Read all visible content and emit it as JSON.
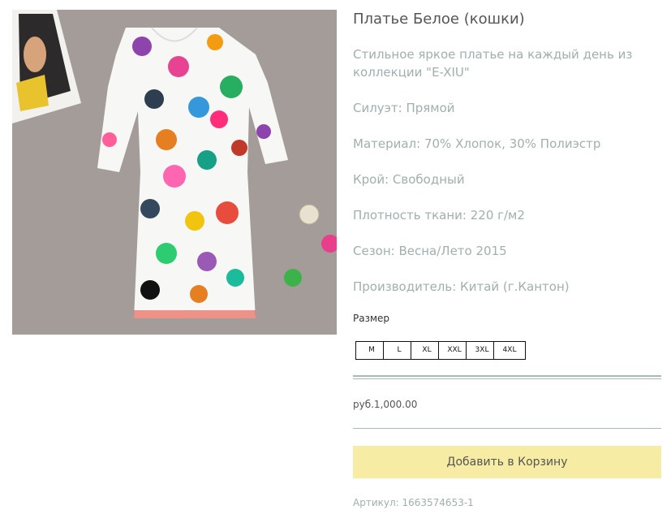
{
  "product": {
    "title": "Платье Белое (кошки)",
    "description": [
      "Стильное яркое платье на каждый день из коллекции \"E-XIU\"",
      "Силуэт: Прямой",
      "Материал: 70% Хлопок, 30% Полиэстр",
      "Крой: Свободный",
      "Плотность ткани: 220 г/м2",
      "Сезон: Весна/Лето 2015",
      "Производитель: Китай (г.Кантон)"
    ],
    "size_label": "Размер",
    "sizes": [
      "M",
      "L",
      "XL",
      "XXL",
      "3XL",
      "4XL"
    ],
    "price": "руб.1,000.00",
    "add_to_cart_label": "Добавить в Корзину",
    "sku": "Артикул: 1663574653-1"
  },
  "colors": {
    "cart_button_bg": "#f6eca3",
    "description_text": "#9fb0ad",
    "divider": "#a9b9b6",
    "photo_background": "#a39c98"
  }
}
